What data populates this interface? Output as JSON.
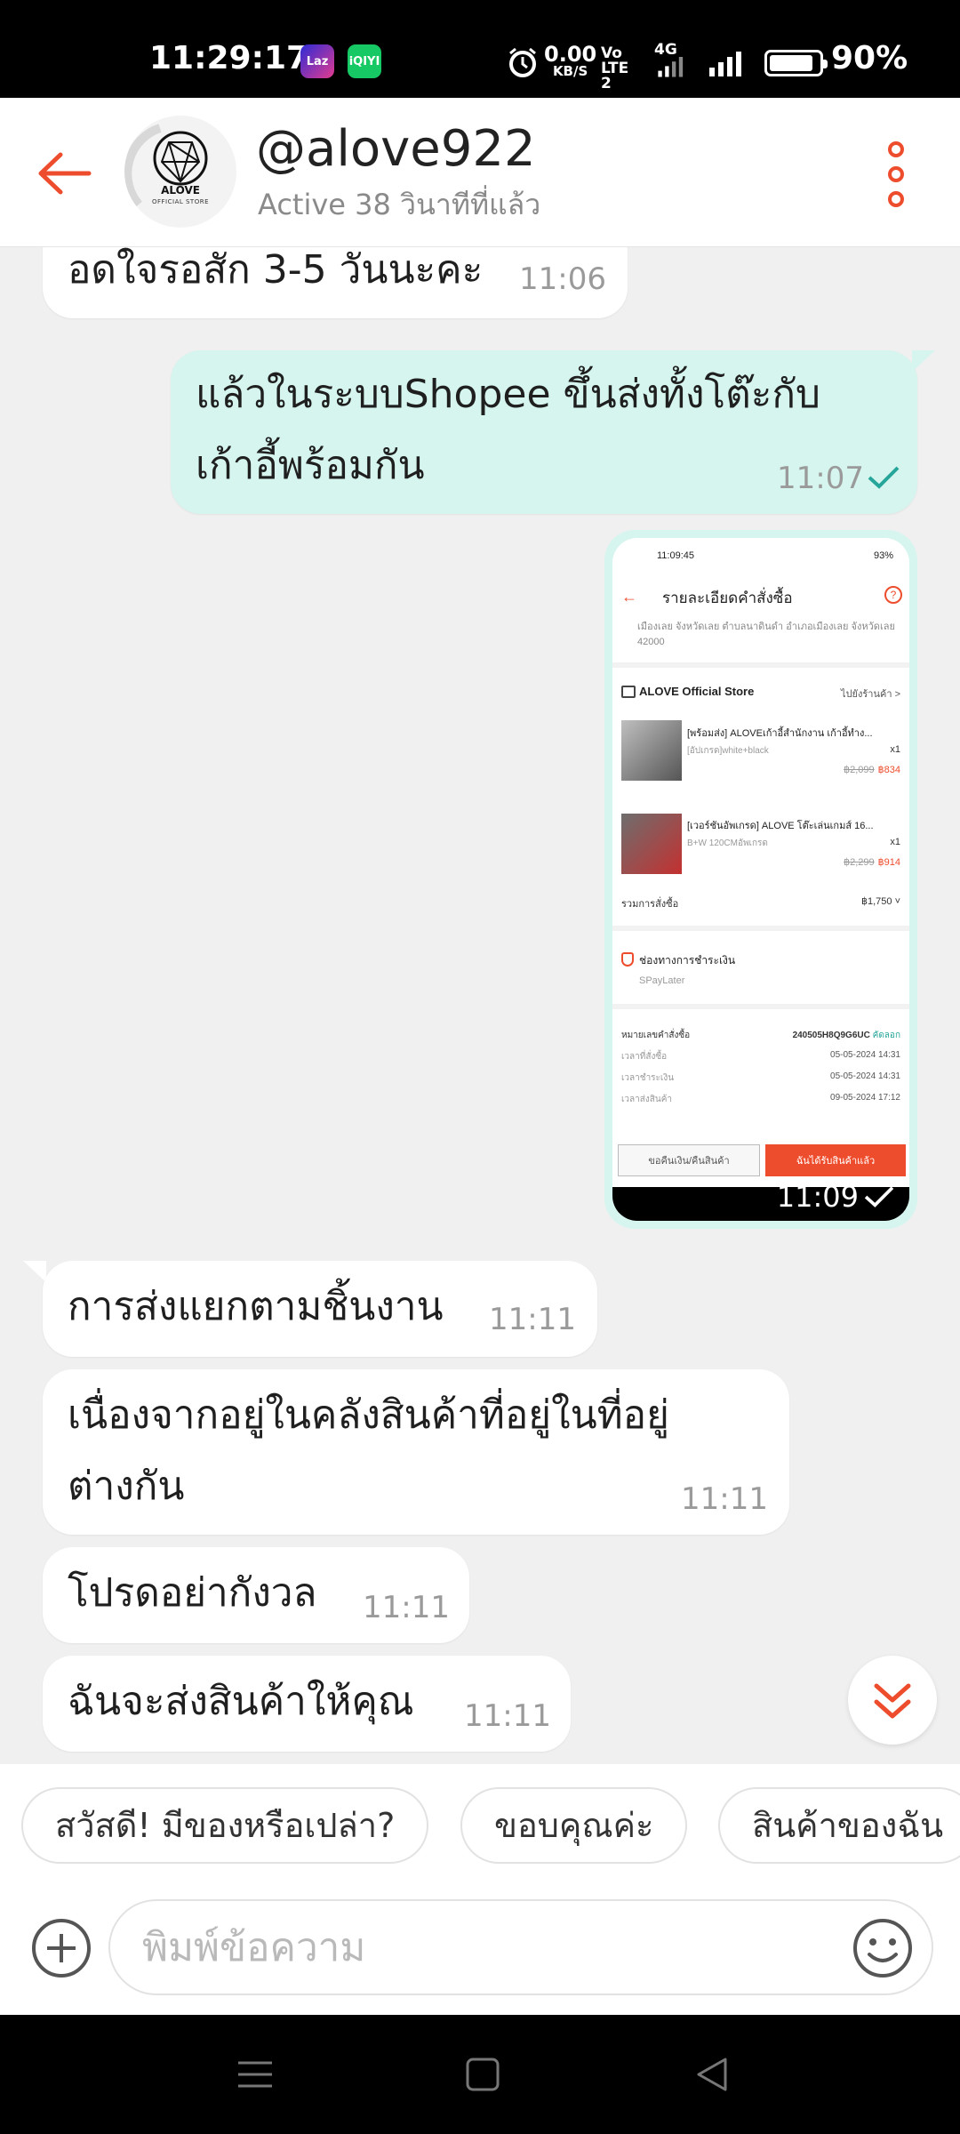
{
  "status_bar": {
    "time": "11:29:17",
    "app_icon_1": "Laz",
    "app_icon_2": "iQIYI",
    "speed_value": "0.00",
    "speed_unit": "KB/S",
    "volte": "Vo LTE2",
    "network": "4G",
    "battery_level": 0.9,
    "battery_pct": "90%"
  },
  "header": {
    "contact_name": "@alove922",
    "status": "Active 38 วินาทีที่แล้ว",
    "avatar_brand": "ALOVE",
    "avatar_brand_sub": "OFFICIAL STORE"
  },
  "messages": {
    "m1": {
      "text": "อดใจรอสัก 3-5 วันนะคะ",
      "time": "11:06"
    },
    "m2": {
      "line1": "แล้วในระบบShopee ขึ้นส่งทั้งโต๊ะกับ",
      "line2": "เก้าอี้พร้อมกัน",
      "time": "11:07"
    },
    "m3_image_time": "11:09",
    "m4": {
      "text": "การส่งแยกตามชิ้นงาน",
      "time": "11:11"
    },
    "m5": {
      "line1": "เนื่องจากอยู่ในคลังสินค้าที่อยู่ในที่อยู่",
      "line2": "ต่างกัน",
      "time": "11:11"
    },
    "m6": {
      "text": "โปรดอย่ากังวล",
      "time": "11:11"
    },
    "m7": {
      "text": "ฉันจะส่งสินค้าให้คุณ",
      "time": "11:11"
    }
  },
  "screenshot": {
    "time": "11:09:45",
    "battery": "93%",
    "title": "รายละเอียดคำสั่งซื้อ",
    "address": "เมืองเลย จังหวัดเลย ตำบลนาดินดำ อำเภอเมืองเลย จังหวัดเลย 42000",
    "store": "ALOVE Official Store",
    "store_link": "ไปยังร้านค้า >",
    "item1": {
      "name": "[พร้อมส่ง] ALOVEเก้าอี้สำนักงาน เก้าอี้ทำง...",
      "variant": "[อัปเกรด]white+black",
      "qty": "x1",
      "old_price": "฿2,099",
      "price": "฿834"
    },
    "item2": {
      "name": "[เวอร์ชันอัพเกรด] ALOVE โต๊ะเล่นเกมส์ 16...",
      "variant": "B+W 120CMอัพเกรด",
      "qty": "x1",
      "old_price": "฿2,299",
      "price": "฿914"
    },
    "total_label": "รวมการสั่งซื้อ",
    "total": "฿1,750 ˅",
    "pay_title": "ช่องทางการชำระเงิน",
    "pay_method": "SPayLater",
    "order_no_label": "หมายเลขคำสั่งซื้อ",
    "order_no": "240505H8Q9G6UC",
    "order_copy": "คัดลอก",
    "rows": [
      {
        "label": "เวลาที่สั่งซื้อ",
        "value": "05-05-2024 14:31"
      },
      {
        "label": "เวลาชำระเงิน",
        "value": "05-05-2024 14:31"
      },
      {
        "label": "เวลาส่งสินค้า",
        "value": "09-05-2024 17:12"
      }
    ],
    "btn_refund": "ขอคืนเงิน/คืนสินค้า",
    "btn_received": "ฉันได้รับสินค้าแล้ว"
  },
  "quick_replies": [
    "สวัสดี! มีของหรือเปล่า?",
    "ขอบคุณค่ะ",
    "สินค้าของฉัน"
  ],
  "input": {
    "placeholder": "พิมพ์ข้อความ"
  },
  "colors": {
    "accent": "#ee4d2d",
    "sent_bubble": "#d5f5ee",
    "check": "#26a69a"
  }
}
